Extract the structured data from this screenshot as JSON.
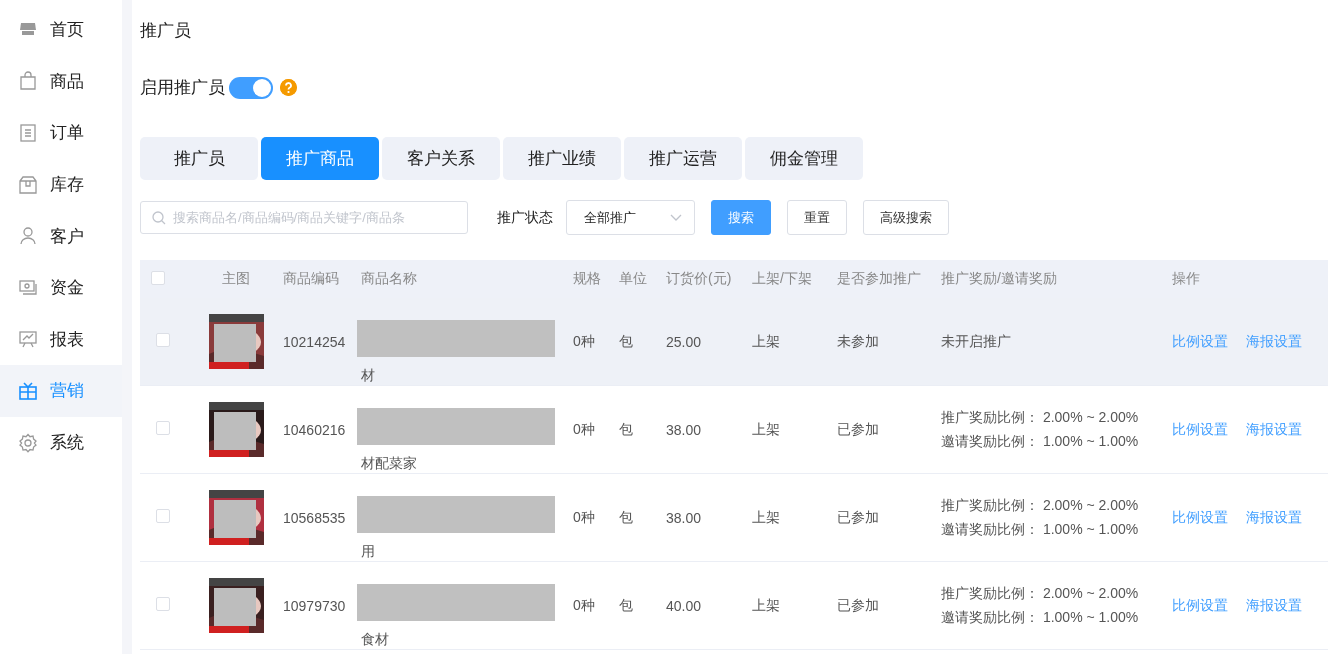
{
  "sidebar": {
    "items": [
      {
        "label": "首页",
        "selected": false
      },
      {
        "label": "商品",
        "selected": false
      },
      {
        "label": "订单",
        "selected": false
      },
      {
        "label": "库存",
        "selected": false
      },
      {
        "label": "客户",
        "selected": false
      },
      {
        "label": "资金",
        "selected": false
      },
      {
        "label": "报表",
        "selected": false
      },
      {
        "label": "营销",
        "selected": true
      },
      {
        "label": "系统",
        "selected": false
      }
    ]
  },
  "page": {
    "title": "推广员"
  },
  "enable": {
    "label": "启用推广员",
    "on": true
  },
  "tabs": [
    {
      "label": "推广员",
      "selected": false
    },
    {
      "label": "推广商品",
      "selected": true
    },
    {
      "label": "客户关系",
      "selected": false
    },
    {
      "label": "推广业绩",
      "selected": false
    },
    {
      "label": "推广运营",
      "selected": false
    },
    {
      "label": "佣金管理",
      "selected": false
    }
  ],
  "filters": {
    "search": {
      "placeholder": "搜索商品名/商品编码/商品关键字/商品条"
    },
    "status_label": "推广状态",
    "status_value": "全部推广",
    "buttons": [
      {
        "label": "搜索",
        "kind": "primary"
      },
      {
        "label": "重置",
        "kind": "default"
      },
      {
        "label": "高级搜索",
        "kind": "default"
      }
    ]
  },
  "table": {
    "all_checked": false,
    "columns": [
      "主图",
      "商品编码",
      "商品名称",
      "规格",
      "单位",
      "订货价(元)",
      "上架/下架",
      "是否参加推广",
      "推广奖励/邀请奖励",
      "操作"
    ],
    "rows": [
      {
        "checked": false,
        "highlighted": true,
        "code": "10214254",
        "name_tail": "材",
        "spec": "0种",
        "unit": "包",
        "price": "25.00",
        "shelf": "上架",
        "joined": "未参加",
        "rewards": [
          "未开启推广"
        ],
        "actions": [
          "比例设置",
          "海报设置"
        ]
      },
      {
        "checked": false,
        "highlighted": false,
        "code": "10460216",
        "name_tail": "材配菜家",
        "spec": "0种",
        "unit": "包",
        "price": "38.00",
        "shelf": "上架",
        "joined": "已参加",
        "rewards": [
          "推广奖励比例： 2.00% ~ 2.00%",
          "邀请奖励比例： 1.00% ~ 1.00%"
        ],
        "actions": [
          "比例设置",
          "海报设置"
        ]
      },
      {
        "checked": false,
        "highlighted": false,
        "code": "10568535",
        "name_tail": "用",
        "spec": "0种",
        "unit": "包",
        "price": "38.00",
        "shelf": "上架",
        "joined": "已参加",
        "rewards": [
          "推广奖励比例： 2.00% ~ 2.00%",
          "邀请奖励比例： 1.00% ~ 1.00%"
        ],
        "actions": [
          "比例设置",
          "海报设置"
        ]
      },
      {
        "checked": false,
        "highlighted": false,
        "code": "10979730",
        "name_tail": "食材",
        "spec": "0种",
        "unit": "包",
        "price": "40.00",
        "shelf": "上架",
        "joined": "已参加",
        "rewards": [
          "推广奖励比例： 2.00% ~ 2.00%",
          "邀请奖励比例： 1.00% ~ 1.00%"
        ],
        "actions": [
          "比例设置",
          "海报设置"
        ]
      }
    ]
  }
}
